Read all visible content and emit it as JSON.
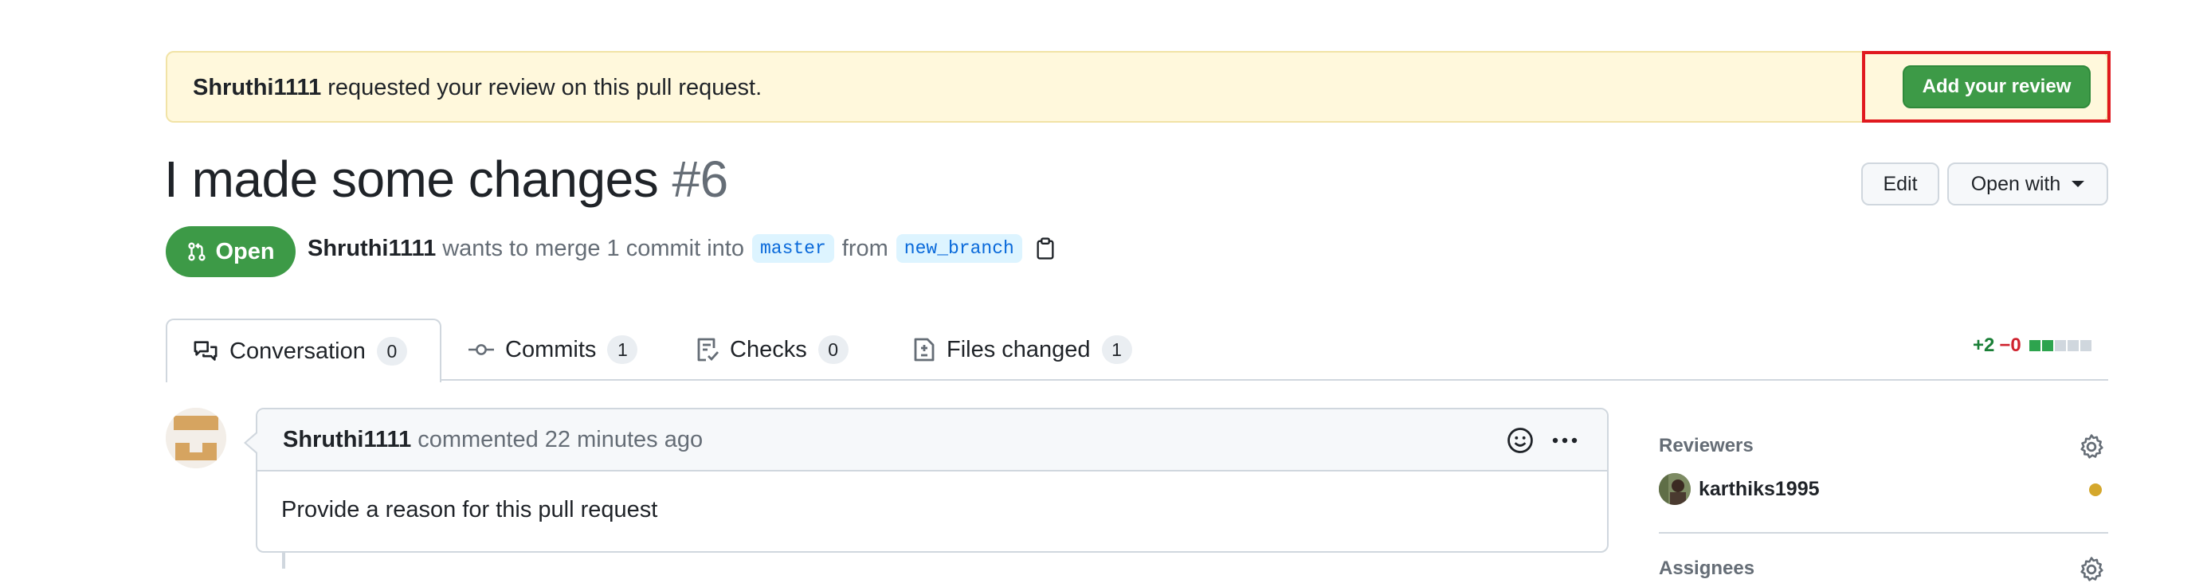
{
  "banner": {
    "requester": "Shruthi1111",
    "message": "requested your review on this pull request.",
    "add_review_label": "Add your review"
  },
  "pr": {
    "title": "I made some changes",
    "number": "#6",
    "state": "Open",
    "author": "Shruthi1111",
    "merge_text": "wants to merge 1 commit into",
    "base_branch": "master",
    "from_text": "from",
    "head_branch": "new_branch"
  },
  "header_buttons": {
    "edit": "Edit",
    "open_with": "Open with"
  },
  "tabs": [
    {
      "label": "Conversation",
      "count": "0",
      "icon": "comment-discussion-icon",
      "selected": true
    },
    {
      "label": "Commits",
      "count": "1",
      "icon": "git-commit-icon",
      "selected": false
    },
    {
      "label": "Checks",
      "count": "0",
      "icon": "checklist-icon",
      "selected": false
    },
    {
      "label": "Files changed",
      "count": "1",
      "icon": "file-diff-icon",
      "selected": false
    }
  ],
  "diffstat": {
    "additions": "+2",
    "deletions": "−0",
    "colors": {
      "add": "#1a7f37",
      "neutral": "#d0d7de"
    }
  },
  "comment": {
    "author": "Shruthi1111",
    "action": "commented 22 minutes ago",
    "body": "Provide a reason for this pull request"
  },
  "sidebar": {
    "reviewers_title": "Reviewers",
    "reviewer": "karthiks1995",
    "reviewer_status_color": "#d4a72c",
    "assignees_title": "Assignees"
  },
  "colors": {
    "accent_green": "#3d9a47",
    "banner_bg": "#fff8dc",
    "highlight_red": "#e0191f"
  }
}
